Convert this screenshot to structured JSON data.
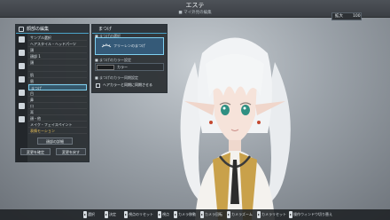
{
  "window": {
    "title": "エステ",
    "subtitle": "■ マイ外見の編集"
  },
  "zoom": {
    "label": "拡大",
    "value": "100"
  },
  "left_panel": {
    "title": "顔部の編集",
    "rows": [
      {
        "label": "サンプル選択"
      },
      {
        "label": "ヘアスタイル・ヘッドパーツ"
      },
      {
        "label": "頭"
      },
      {
        "label": "顔部 1"
      },
      {
        "label": "頭"
      },
      {
        "label": ""
      },
      {
        "label": "肌"
      },
      {
        "label": "眉"
      },
      {
        "label": "まつげ"
      },
      {
        "label": "目"
      },
      {
        "label": "鼻"
      },
      {
        "label": "口"
      },
      {
        "label": "耳"
      },
      {
        "label": "顔・他"
      },
      {
        "label": "メイク・フェイスペイント"
      },
      {
        "label": "表情モーション"
      }
    ],
    "buttons": {
      "face": "顔部の詳細",
      "confirm": "変更を確定",
      "undo": "変更を戻す"
    }
  },
  "sub_panel": {
    "title": "まつげ",
    "lash_select_label": "■ まつげの選択",
    "lash_name": "フリーレンのまつげ",
    "color_label": "■ まつげのカラー設定",
    "color_value": "カラー",
    "sync_label": "■ まつげのカラー同期設定",
    "sync_text": "ヘアカラーと同期に同期させる"
  },
  "bottom_bar": {
    "items": [
      {
        "key": "",
        "label": "選択"
      },
      {
        "key": "",
        "label": "決定"
      },
      {
        "key": "",
        "label": "視点のリセット"
      },
      {
        "key": "",
        "label": "視点"
      },
      {
        "key": "",
        "label": "カメラ移動"
      },
      {
        "key": "",
        "label": "カメラ回転"
      },
      {
        "key": "",
        "label": "カメラズーム"
      },
      {
        "key": "",
        "label": "カメラリセット"
      },
      {
        "key": "",
        "label": "操作ウィンドウ切り替え"
      }
    ]
  }
}
